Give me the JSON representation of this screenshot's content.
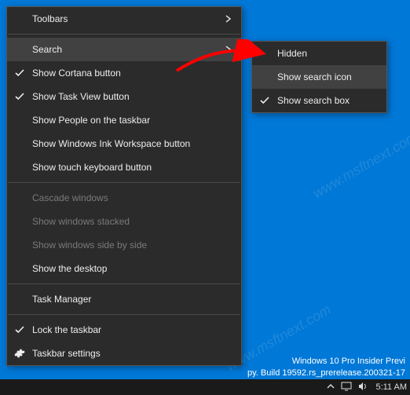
{
  "main_menu": {
    "toolbars": "Toolbars",
    "search": "Search",
    "show_cortana": "Show Cortana button",
    "show_taskview": "Show Task View button",
    "show_people": "Show People on the taskbar",
    "show_ink": "Show Windows Ink Workspace button",
    "show_touch_kb": "Show touch keyboard button",
    "cascade": "Cascade windows",
    "stacked": "Show windows stacked",
    "side_by_side": "Show windows side by side",
    "show_desktop": "Show the desktop",
    "task_manager": "Task Manager",
    "lock_taskbar": "Lock the taskbar",
    "taskbar_settings": "Taskbar settings"
  },
  "sub_menu": {
    "hidden": "Hidden",
    "show_icon": "Show search icon",
    "show_box": "Show search box"
  },
  "desktop": {
    "edition": "Windows 10 Pro Insider Previ",
    "build": "py. Build 19592.rs_prerelease.200321-17",
    "clock": "5:11 AM"
  },
  "watermark_text": "www.msftnext.com"
}
